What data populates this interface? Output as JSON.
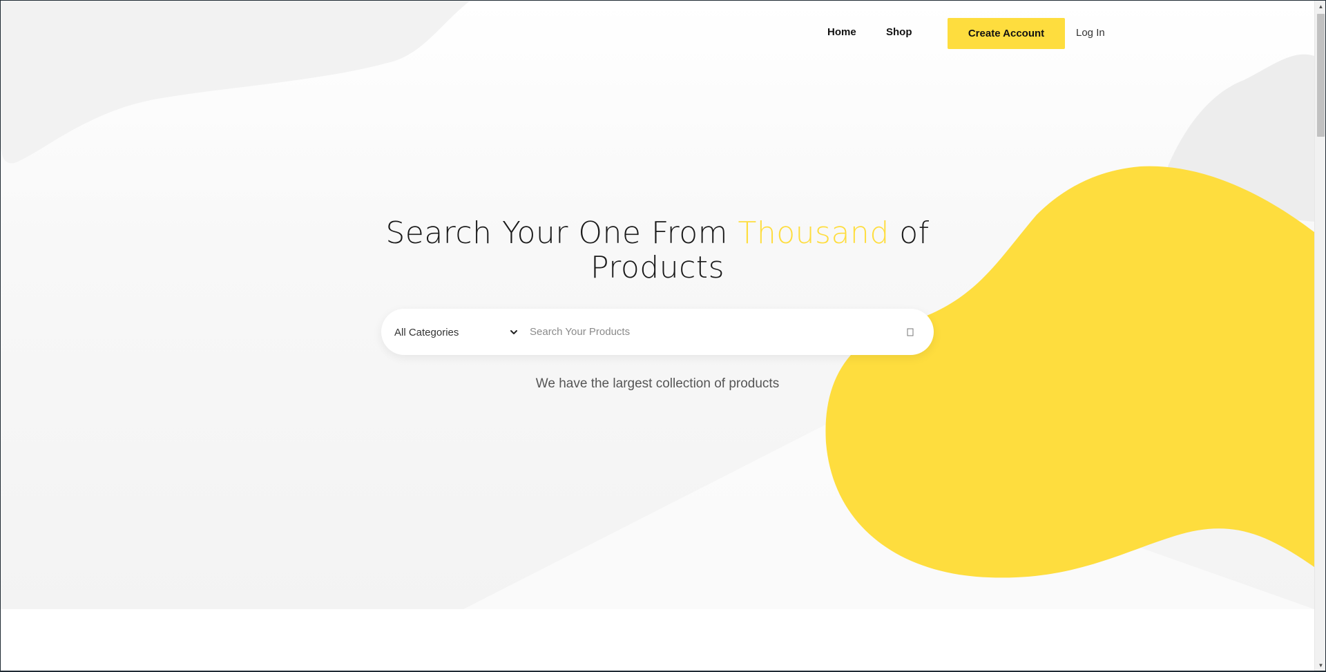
{
  "nav": {
    "home_label": "Home",
    "shop_label": "Shop",
    "create_account_label": "Create Account",
    "login_label": "Log In"
  },
  "hero": {
    "headline_part1": "Search Your One From ",
    "headline_highlight": "Thousand",
    "headline_part2": " of",
    "headline_line2": "Products",
    "tagline": "We have the largest collection of products"
  },
  "search": {
    "category_selected": "All Categories",
    "placeholder": "Search Your Products",
    "value": ""
  },
  "icons": {
    "category_dropdown": "chevron-down-icon",
    "search_button": "search-icon"
  },
  "colors": {
    "accent": "#fedd3e",
    "text_dark": "#1a1a1a",
    "blob_light": "#f2f2f2"
  }
}
